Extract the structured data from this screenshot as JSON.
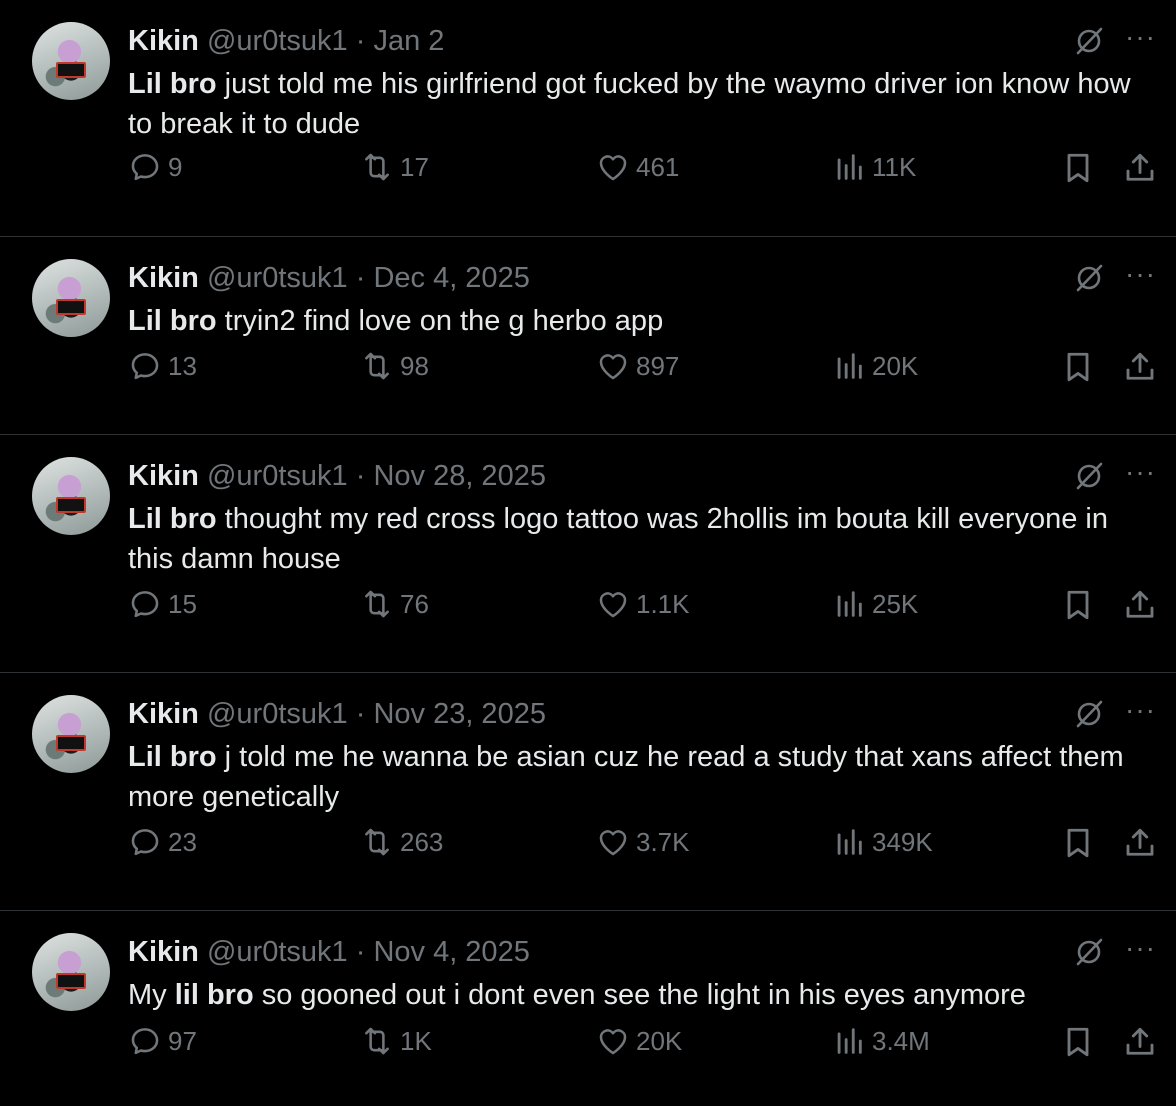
{
  "tweets": [
    {
      "name": "Kikin",
      "handle": "@ur0tsuk1",
      "dot": "·",
      "date": "Jan 2",
      "text_pre": "",
      "text_bold": "Lil bro",
      "text_rest": " just told me his girlfriend got fucked by the waymo driver ion know how to break it to dude",
      "replies": "9",
      "reposts": "17",
      "likes": "461",
      "views": "11K"
    },
    {
      "name": "Kikin",
      "handle": "@ur0tsuk1",
      "dot": "·",
      "date": "Dec 4, 2025",
      "text_pre": "",
      "text_bold": "Lil bro",
      "text_rest": " tryin2 find love on the g herbo app",
      "replies": "13",
      "reposts": "98",
      "likes": "897",
      "views": "20K"
    },
    {
      "name": "Kikin",
      "handle": "@ur0tsuk1",
      "dot": "·",
      "date": "Nov 28, 2025",
      "text_pre": "",
      "text_bold": "Lil bro",
      "text_rest": " thought my red cross logo tattoo was 2hollis im bouta kill everyone in this damn house",
      "replies": "15",
      "reposts": "76",
      "likes": "1.1K",
      "views": "25K"
    },
    {
      "name": "Kikin",
      "handle": "@ur0tsuk1",
      "dot": "·",
      "date": "Nov 23, 2025",
      "text_pre": "",
      "text_bold": "Lil bro",
      "text_rest": " j told me he wanna be asian cuz he read a study that xans affect them more genetically",
      "replies": "23",
      "reposts": "263",
      "likes": "3.7K",
      "views": "349K"
    },
    {
      "name": "Kikin",
      "handle": "@ur0tsuk1",
      "dot": "·",
      "date": "Nov 4, 2025",
      "text_pre": "My ",
      "text_bold": "lil bro",
      "text_rest": " so gooned out i dont even see the light in his eyes anymore",
      "replies": "97",
      "reposts": "1K",
      "likes": "20K",
      "views": "3.4M"
    }
  ],
  "colors": {
    "background": "#000000",
    "text": "#e7e9ea",
    "muted": "#71767b",
    "divider": "#2f3336"
  },
  "icons": [
    "grok-icon",
    "more-icon",
    "reply-icon",
    "repost-icon",
    "like-icon",
    "views-icon",
    "bookmark-icon",
    "share-icon"
  ],
  "more_label": "···"
}
